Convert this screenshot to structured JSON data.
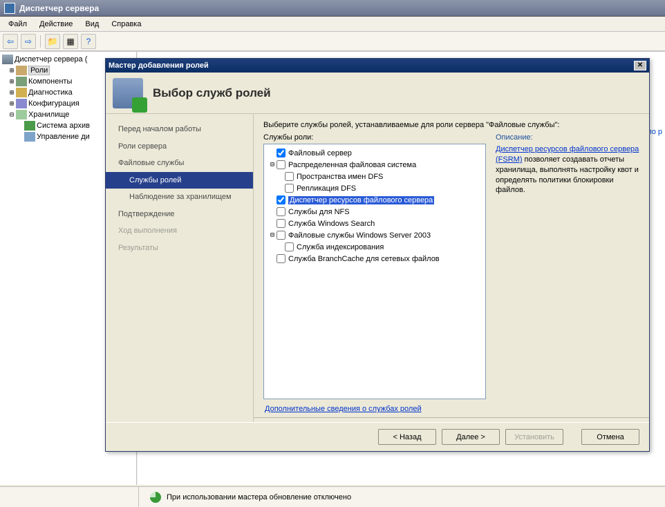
{
  "window": {
    "title": "Диспетчер сервера"
  },
  "menu": {
    "file": "Файл",
    "action": "Действие",
    "view": "Вид",
    "help": "Справка"
  },
  "tree": {
    "root": "Диспетчер сервера (",
    "roles": "Роли",
    "components": "Компоненты",
    "diagnostics": "Диагностика",
    "configuration": "Конфигурация",
    "storage": "Хранилище",
    "archive": "Система архив",
    "disk": "Управление ди"
  },
  "content_hint": "ка по р",
  "wizard": {
    "title": "Мастер добавления ролей",
    "heading": "Выбор служб ролей",
    "prompt": "Выберите службы ролей, устанавливаемые для роли сервера \"Файловые службы\":",
    "services_label": "Службы роли:",
    "description_label": "Описание:",
    "desc_link": "Диспетчер ресурсов файлового сервера (FSRM)",
    "desc_text": " позволяет создавать отчеты хранилища, выполнять настройку квот и определять политики блокировки файлов.",
    "more_link": "Дополнительные сведения о службах ролей",
    "nav": {
      "before": "Перед началом работы",
      "server_roles": "Роли сервера",
      "file_services": "Файловые службы",
      "role_services": "Службы ролей",
      "storage_monitor": "Наблюдение за хранилищем",
      "confirm": "Подтверждение",
      "progress": "Ход выполнения",
      "results": "Результаты"
    },
    "svc": {
      "file_server": "Файловый сервер",
      "dfs": "Распределенная файловая система",
      "dfs_ns": "Пространства имен DFS",
      "dfs_repl": "Репликация DFS",
      "fsrm": "Диспетчер ресурсов файлового сервера",
      "nfs": "Службы для NFS",
      "wsearch": "Служба Windows Search",
      "ws2003": "Файловые службы Windows Server 2003",
      "indexing": "Служба индексирования",
      "branchcache": "Служба BranchCache для сетевых файлов"
    },
    "buttons": {
      "back": "< Назад",
      "next": "Далее >",
      "install": "Установить",
      "cancel": "Отмена"
    }
  },
  "status": {
    "text": "При использовании мастера обновление отключено"
  }
}
